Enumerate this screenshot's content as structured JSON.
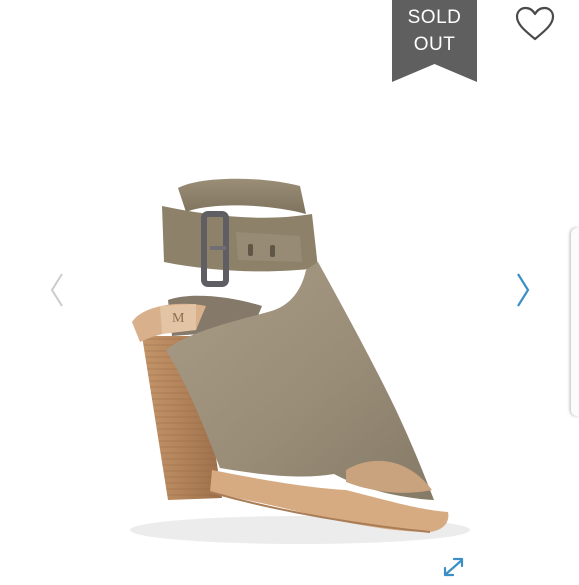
{
  "listing": {
    "badge": {
      "line1": "SOLD",
      "line2": "OUT",
      "color": "#5f5f5f"
    },
    "icons": {
      "favorite": "heart-outline-icon",
      "previous": "chevron-left-icon",
      "next": "chevron-right-icon",
      "expand": "expand-arrows-icon"
    },
    "colors": {
      "suede": "#9b8f7b",
      "leather_strap": "#8d8169",
      "heel_wood": "#b5865c",
      "footbed": "#d9b08c",
      "nav_active": "#3b8fc4",
      "nav_inactive": "#cccccc"
    }
  }
}
